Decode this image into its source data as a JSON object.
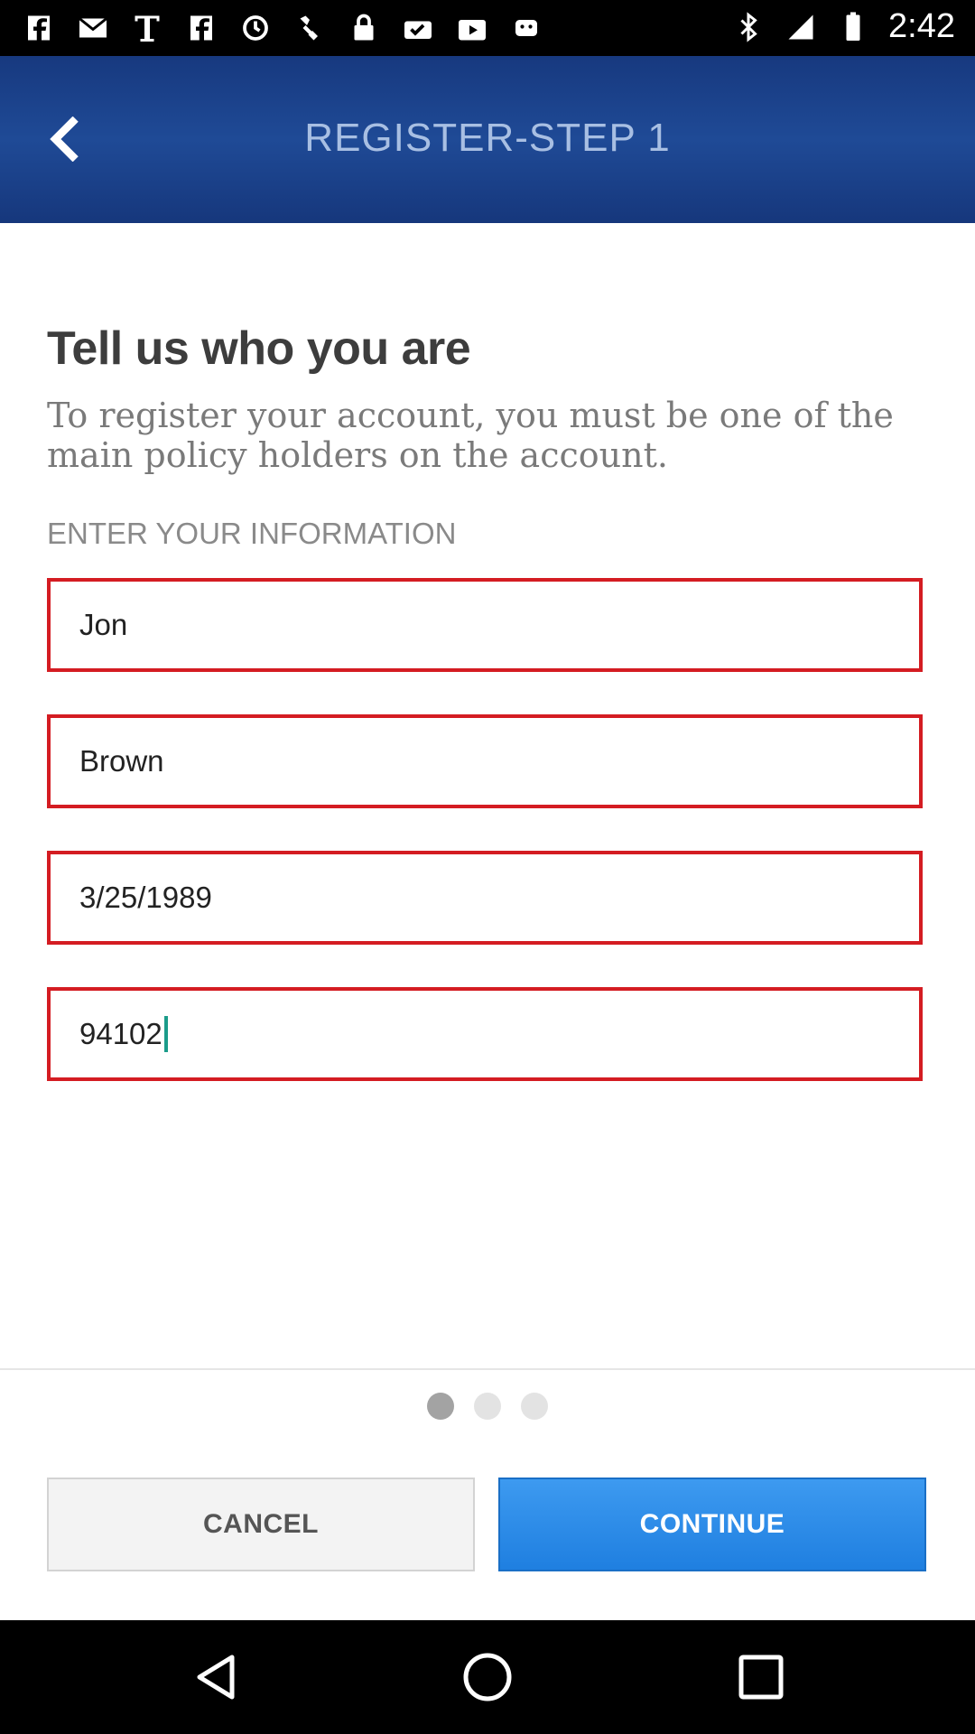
{
  "status_bar": {
    "time": "2:42",
    "icons": [
      "facebook-icon",
      "gmail-icon",
      "text-icon",
      "facebook-icon",
      "sync-icon",
      "satellite-icon",
      "lock-icon",
      "briefcase-check-icon",
      "play-store-icon",
      "android-icon",
      "bluetooth-icon",
      "signal-icon",
      "battery-icon"
    ]
  },
  "app_bar": {
    "title": "REGISTER-STEP 1",
    "back_icon": "chevron-left-icon"
  },
  "content": {
    "heading": "Tell us who you are",
    "subtext": "To register your account, you must be one of the main policy holders on the account.",
    "section_label": "ENTER YOUR INFORMATION",
    "fields": [
      {
        "value": "Jon"
      },
      {
        "value": "Brown"
      },
      {
        "value": "3/25/1989"
      },
      {
        "value": "94102"
      }
    ]
  },
  "pager": {
    "count": 3,
    "active_index": 0
  },
  "buttons": {
    "cancel": "CANCEL",
    "continue": "CONTINUE"
  },
  "colors": {
    "app_bar": "#1f4a96",
    "field_border": "#d41c22",
    "continue_button": "#2a8ae8"
  },
  "nav_bar": {
    "icons": [
      "back-triangle-icon",
      "home-circle-icon",
      "recents-square-icon"
    ]
  }
}
